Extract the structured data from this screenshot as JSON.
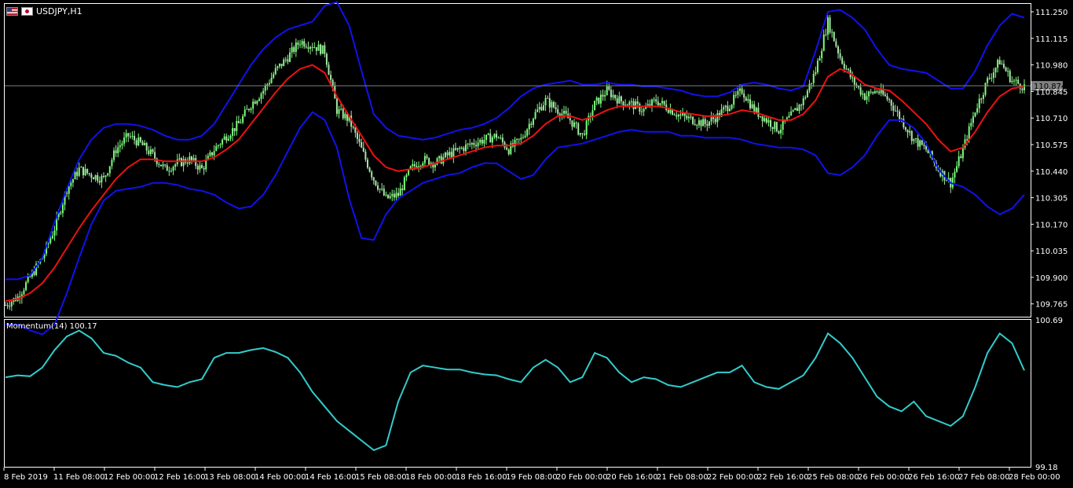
{
  "window": {
    "symbol_title": "USDJPY,H1",
    "icons": [
      "us-flag-icon",
      "jp-flag-icon"
    ]
  },
  "chart_data": [
    {
      "type": "candlestick",
      "pane": "price",
      "symbol": "USDJPY",
      "timeframe": "H1",
      "ylim": [
        109.7,
        111.29
      ],
      "y_ticks": [
        "111.250",
        "111.115",
        "110.980",
        "110.845",
        "110.710",
        "110.575",
        "110.440",
        "110.305",
        "110.170",
        "110.035",
        "109.900",
        "109.765"
      ],
      "current_price": "110.874",
      "colors": {
        "bull": "#7CFC7C",
        "bear": "#A8E6A8",
        "bollinger": "#1111EE",
        "moving_average": "#EE1111",
        "price_line": "#808080"
      },
      "series": [
        {
          "name": "close",
          "values": [
            109.76,
            109.8,
            109.9,
            110.0,
            110.15,
            110.35,
            110.45,
            110.42,
            110.4,
            110.55,
            110.62,
            110.58,
            110.52,
            110.45,
            110.48,
            110.5,
            110.45,
            110.55,
            110.62,
            110.68,
            110.78,
            110.85,
            110.95,
            111.02,
            111.1,
            111.08,
            111.05,
            110.75,
            110.7,
            110.55,
            110.4,
            110.3,
            110.32,
            110.45,
            110.5,
            110.48,
            110.52,
            110.55,
            110.58,
            110.6,
            110.62,
            110.55,
            110.6,
            110.72,
            110.8,
            110.75,
            110.7,
            110.62,
            110.78,
            110.85,
            110.8,
            110.78,
            110.75,
            110.8,
            110.76,
            110.72,
            110.7,
            110.68,
            110.72,
            110.78,
            110.85,
            110.75,
            110.7,
            110.65,
            110.72,
            110.8,
            110.95,
            111.2,
            111.02,
            110.9,
            110.82,
            110.85,
            110.8,
            110.7,
            110.6,
            110.55,
            110.45,
            110.38,
            110.55,
            110.75,
            110.9,
            111.0,
            110.9,
            110.87
          ]
        },
        {
          "name": "moving-average",
          "values": [
            109.78,
            109.79,
            109.82,
            109.87,
            109.95,
            110.05,
            110.15,
            110.24,
            110.32,
            110.4,
            110.46,
            110.5,
            110.5,
            110.49,
            110.49,
            110.49,
            110.49,
            110.51,
            110.55,
            110.6,
            110.68,
            110.76,
            110.84,
            110.91,
            110.96,
            110.98,
            110.94,
            110.82,
            110.72,
            110.62,
            110.52,
            110.46,
            110.44,
            110.45,
            110.46,
            110.48,
            110.5,
            110.52,
            110.54,
            110.56,
            110.57,
            110.57,
            110.58,
            110.62,
            110.68,
            110.72,
            110.72,
            110.7,
            110.72,
            110.75,
            110.77,
            110.77,
            110.77,
            110.77,
            110.76,
            110.74,
            110.73,
            110.72,
            110.72,
            110.73,
            110.75,
            110.74,
            110.72,
            110.7,
            110.7,
            110.73,
            110.8,
            110.92,
            110.96,
            110.93,
            110.88,
            110.86,
            110.85,
            110.8,
            110.74,
            110.68,
            110.6,
            110.54,
            110.56,
            110.64,
            110.74,
            110.82,
            110.86,
            110.87
          ]
        },
        {
          "name": "bollinger-upper",
          "values": [
            109.89,
            109.89,
            109.91,
            110.0,
            110.18,
            110.35,
            110.5,
            110.6,
            110.66,
            110.68,
            110.68,
            110.67,
            110.65,
            110.62,
            110.6,
            110.6,
            110.62,
            110.68,
            110.78,
            110.88,
            110.98,
            111.06,
            111.12,
            111.16,
            111.18,
            111.2,
            111.28,
            111.3,
            111.18,
            110.95,
            110.73,
            110.66,
            110.62,
            110.61,
            110.6,
            110.61,
            110.63,
            110.65,
            110.66,
            110.68,
            110.71,
            110.76,
            110.82,
            110.86,
            110.88,
            110.89,
            110.9,
            110.88,
            110.88,
            110.89,
            110.88,
            110.88,
            110.87,
            110.87,
            110.86,
            110.85,
            110.83,
            110.82,
            110.82,
            110.84,
            110.88,
            110.89,
            110.88,
            110.86,
            110.85,
            110.87,
            111.05,
            111.25,
            111.26,
            111.22,
            111.16,
            111.06,
            110.98,
            110.96,
            110.95,
            110.94,
            110.9,
            110.86,
            110.86,
            110.95,
            111.08,
            111.18,
            111.24,
            111.22
          ]
        },
        {
          "name": "bollinger-lower",
          "values": [
            109.66,
            109.66,
            109.63,
            109.61,
            109.66,
            109.82,
            110.0,
            110.17,
            110.29,
            110.34,
            110.35,
            110.36,
            110.38,
            110.38,
            110.37,
            110.35,
            110.34,
            110.32,
            110.28,
            110.25,
            110.26,
            110.32,
            110.42,
            110.54,
            110.66,
            110.74,
            110.7,
            110.56,
            110.3,
            110.1,
            110.09,
            110.22,
            110.3,
            110.34,
            110.38,
            110.4,
            110.42,
            110.43,
            110.46,
            110.48,
            110.48,
            110.44,
            110.4,
            110.42,
            110.5,
            110.56,
            110.57,
            110.58,
            110.6,
            110.62,
            110.64,
            110.65,
            110.64,
            110.64,
            110.64,
            110.62,
            110.62,
            110.61,
            110.61,
            110.61,
            110.6,
            110.58,
            110.57,
            110.56,
            110.56,
            110.55,
            110.52,
            110.43,
            110.42,
            110.46,
            110.52,
            110.62,
            110.7,
            110.7,
            110.66,
            110.58,
            110.45,
            110.38,
            110.36,
            110.32,
            110.26,
            110.22,
            110.25,
            110.32
          ]
        }
      ]
    },
    {
      "type": "line",
      "pane": "momentum",
      "indicator_label": "Momentum(14) 100.17",
      "ylim": [
        99.18,
        100.69
      ],
      "y_ticks": [
        "100.69",
        "99.18"
      ],
      "colors": {
        "momentum": "#33CCCC"
      },
      "series": [
        {
          "name": "momentum",
          "values": [
            100.1,
            100.12,
            100.11,
            100.2,
            100.38,
            100.52,
            100.58,
            100.5,
            100.35,
            100.32,
            100.25,
            100.2,
            100.05,
            100.02,
            100.0,
            100.05,
            100.08,
            100.3,
            100.35,
            100.35,
            100.38,
            100.4,
            100.36,
            100.3,
            100.15,
            99.95,
            99.8,
            99.65,
            99.55,
            99.45,
            99.35,
            99.4,
            99.85,
            100.15,
            100.22,
            100.2,
            100.18,
            100.18,
            100.15,
            100.13,
            100.12,
            100.08,
            100.05,
            100.2,
            100.28,
            100.2,
            100.05,
            100.1,
            100.35,
            100.3,
            100.15,
            100.05,
            100.1,
            100.08,
            100.02,
            100.0,
            100.05,
            100.1,
            100.15,
            100.15,
            100.22,
            100.05,
            100.0,
            99.98,
            100.05,
            100.12,
            100.3,
            100.55,
            100.45,
            100.3,
            100.1,
            99.9,
            99.8,
            99.75,
            99.85,
            99.7,
            99.65,
            99.6,
            99.7,
            100.0,
            100.35,
            100.55,
            100.45,
            100.17
          ]
        }
      ]
    }
  ],
  "x_axis": {
    "labels": [
      "8 Feb 2019",
      "11 Feb 08:00",
      "12 Feb 00:00",
      "12 Feb 16:00",
      "13 Feb 08:00",
      "14 Feb 00:00",
      "14 Feb 16:00",
      "15 Feb 08:00",
      "18 Feb 00:00",
      "18 Feb 16:00",
      "19 Feb 08:00",
      "20 Feb 00:00",
      "20 Feb 16:00",
      "21 Feb 08:00",
      "22 Feb 00:00",
      "22 Feb 16:00",
      "25 Feb 08:00",
      "26 Feb 00:00",
      "26 Feb 16:00",
      "27 Feb 08:00",
      "28 Feb 00:00"
    ]
  }
}
